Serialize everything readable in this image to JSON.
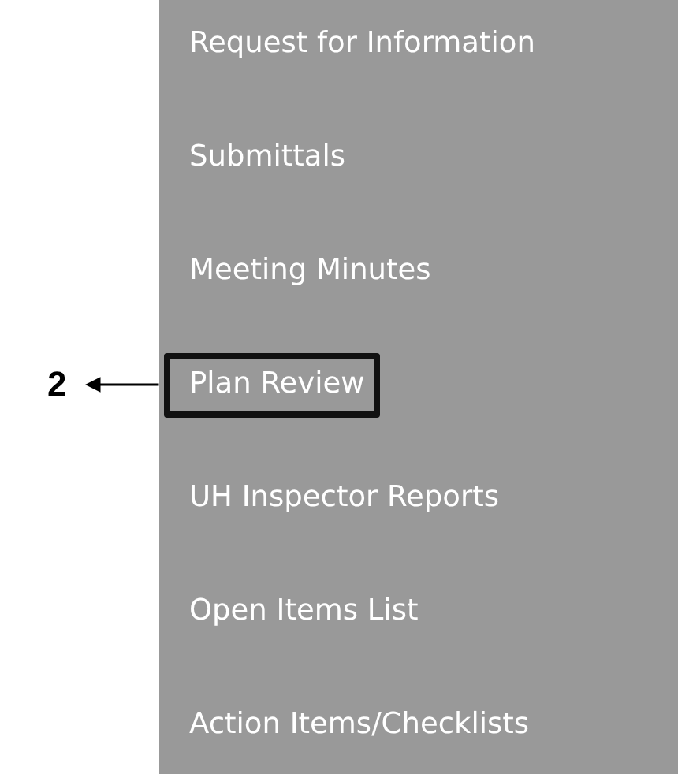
{
  "menu": {
    "items": [
      {
        "label": "Request for Information",
        "highlighted": false
      },
      {
        "label": "Submittals",
        "highlighted": false
      },
      {
        "label": "Meeting Minutes",
        "highlighted": false
      },
      {
        "label": "Plan Review",
        "highlighted": true
      },
      {
        "label": "UH Inspector Reports",
        "highlighted": false
      },
      {
        "label": "Open Items List",
        "highlighted": false
      },
      {
        "label": "Action Items/Checklists",
        "highlighted": false
      }
    ]
  },
  "callout": {
    "label": "2"
  }
}
